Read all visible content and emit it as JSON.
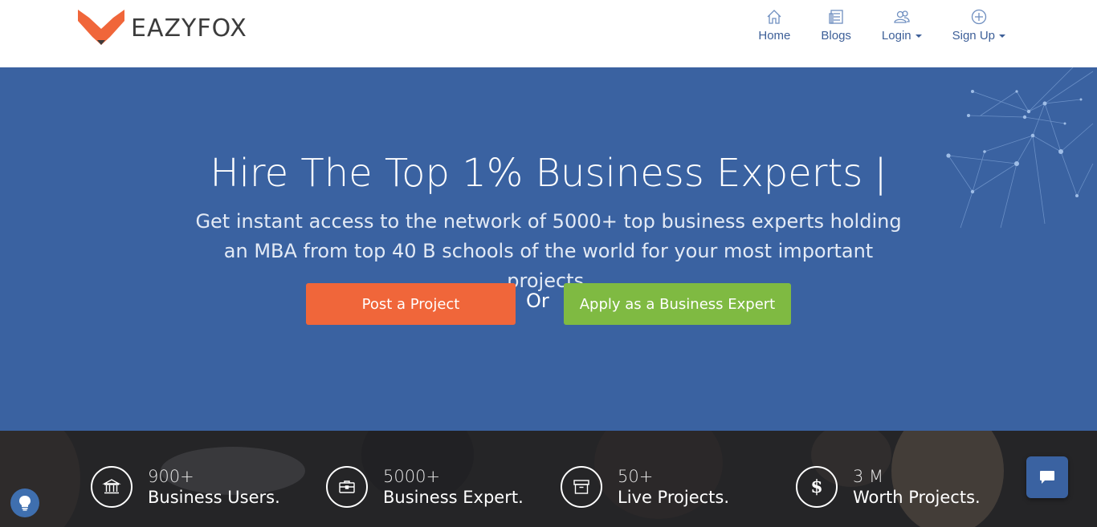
{
  "brand": {
    "name": "EAZYFOX",
    "accent": "#f0663a"
  },
  "nav": {
    "items": [
      {
        "label": "Home",
        "icon": "home-icon",
        "dropdown": false
      },
      {
        "label": "Blogs",
        "icon": "blog-icon",
        "dropdown": false
      },
      {
        "label": "Login",
        "icon": "users-icon",
        "dropdown": true
      },
      {
        "label": "Sign Up",
        "icon": "plus-circle-icon",
        "dropdown": true
      }
    ]
  },
  "hero": {
    "title": "Hire The Top 1% Business Experts",
    "cursor": "|",
    "subtitle": "Get instant access to the network of 5000+ top business experts holding an MBA from top 40 B schools of the world for your most important projects.",
    "post_button": "Post a Project",
    "or_text": "Or",
    "apply_button": "Apply as a Business Expert",
    "background": "#3a62a1"
  },
  "stats": [
    {
      "number": "900+",
      "label": "Business Users.",
      "icon": "bank-icon"
    },
    {
      "number": "5000+",
      "label": "Business Expert.",
      "icon": "briefcase-icon"
    },
    {
      "number": "50+",
      "label": "Live Projects.",
      "icon": "archive-icon"
    },
    {
      "number": "3 M",
      "label": "Worth Projects.",
      "icon": "dollar-icon"
    }
  ],
  "widgets": {
    "chat": "chat-icon",
    "help": "lightbulb-icon"
  }
}
